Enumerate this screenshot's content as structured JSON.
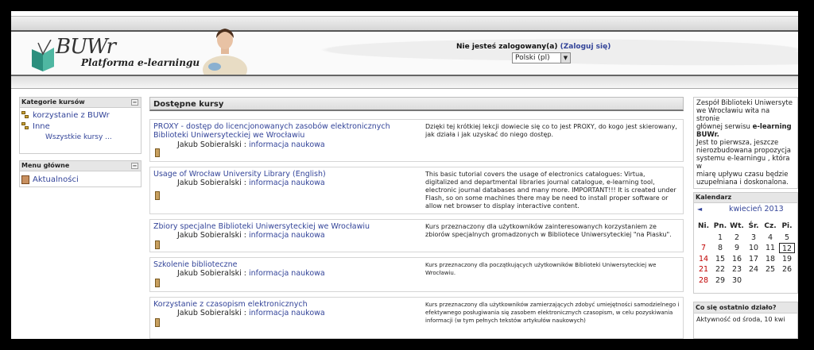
{
  "header": {
    "logo_text": "BUWr",
    "logo_subtitle": "Platforma e-learningu",
    "login_prefix": "Nie jesteś zalogowany(a)",
    "login_link": "(Zaloguj się)",
    "language": "Polski (pl)"
  },
  "categories_block": {
    "title": "Kategorie kursów",
    "toggle": "−",
    "items": [
      "korzystanie z BUWr",
      "Inne"
    ],
    "all_courses": "Wszystkie kursy ..."
  },
  "main_menu_block": {
    "title": "Menu główne",
    "toggle": "−",
    "items": [
      "Aktualności"
    ]
  },
  "courses": {
    "header": "Dostępne kursy",
    "list": [
      {
        "title": "PROXY - dostęp do licencjonowanych zasobów elektronicznych Biblioteki Uniwersyteckiej we Wrocławiu",
        "teacher": "Jakub Sobieralski",
        "teacher_sep": " : ",
        "teacher_role": "informacja naukowa",
        "description": "Dzięki tej krótkiej lekcji dowiecie się co to jest PROXY, do kogo jest skierowany, jak działa i jak uzyskać do niego dostęp."
      },
      {
        "title": "Usage of Wrocław University Library (English)",
        "teacher": "Jakub Sobieralski",
        "teacher_sep": " : ",
        "teacher_role": "informacja naukowa",
        "description": "This basic tutorial covers the usage of electronics catalogues: Virtua, digitalized and departmental libraries journal catalogue, e-learning tool, electronic journal databases and many more. IMPORTANT!!! It is created under Flash, so on some machines there may be need to install proper software or allow net browser to display interactive content."
      },
      {
        "title": "Zbiory specjalne Biblioteki Uniwersyteckiej we Wrocławiu",
        "teacher": "Jakub Sobieralski",
        "teacher_sep": " : ",
        "teacher_role": "informacja naukowa",
        "description": "Kurs przeznaczony dla użytkowników zainteresowanych korzystaniem ze zbiorów specjalnych gromadzonych w Bibliotece Uniwersyteckiej \"na Piasku\"."
      },
      {
        "title": "Szkolenie biblioteczne",
        "teacher": "Jakub Sobieralski",
        "teacher_sep": " : ",
        "teacher_role": "informacja naukowa",
        "description": "Kurs przeznaczony dla początkujących użytkowników Biblioteki Uniwersyteckiej we Wrocławiu."
      },
      {
        "title": "Korzystanie z czasopism elektronicznych",
        "teacher": "Jakub Sobieralski",
        "teacher_sep": " : ",
        "teacher_role": "informacja naukowa",
        "description": "Kurs przeznaczony dla użytkowników zamierzających zdobyć umiejętności samodzielnego i efektywnego posługiwania się zasobem elektronicznych czasopism, w celu pozyskiwania informacji (w tym pełnych tekstów artykułów naukowych)"
      }
    ]
  },
  "welcome": {
    "line1": "Zespół Biblioteki Uniwersyte",
    "line2": "we Wrocławiu wita na stronie",
    "line3": "głównej serwisu",
    "bold": "e-learning BUWr.",
    "line4": "Jest to pierwsza, jeszcze",
    "line5": "nierozbudowana propozycja",
    "line6": "systemu e-learningu , która w",
    "line7": "miarę upływu czasu będzie",
    "line8": "uzupełniana i doskonalona."
  },
  "calendar": {
    "title": "Kalendarz",
    "prev": "◄",
    "month": "kwiecień 2013",
    "days_of_week": [
      "Ni.",
      "Pn.",
      "Wt.",
      "Śr.",
      "Cz.",
      "Pi."
    ],
    "weeks": [
      [
        "",
        "1",
        "2",
        "3",
        "4",
        "5"
      ],
      [
        "7",
        "8",
        "9",
        "10",
        "11",
        "12"
      ],
      [
        "14",
        "15",
        "16",
        "17",
        "18",
        "19"
      ],
      [
        "21",
        "22",
        "23",
        "24",
        "25",
        "26"
      ],
      [
        "28",
        "29",
        "30",
        "",
        "",
        ""
      ]
    ],
    "today": "12"
  },
  "recent": {
    "title": "Co się ostatnio działo?",
    "text": "Aktywność od środa, 10 kwi"
  }
}
